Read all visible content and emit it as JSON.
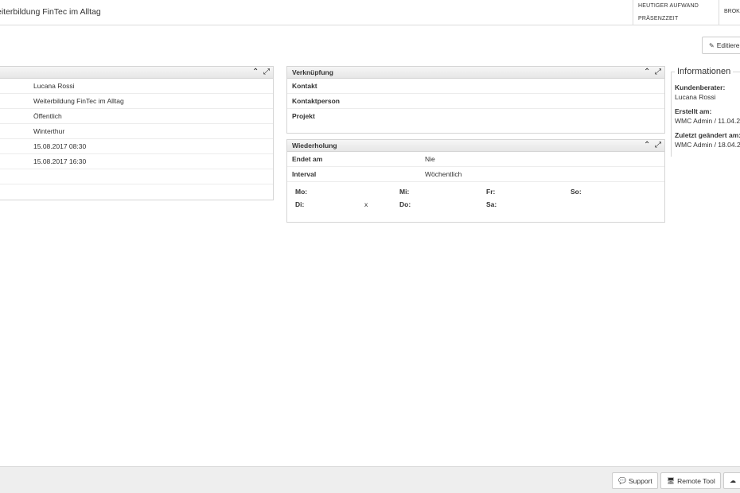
{
  "header": {
    "title": "eiterbildung FinTec im Alltag",
    "today_effort": "HEUTIGER AUFWAND",
    "presence": "PRÄSENZZEIT",
    "broker": "BROK"
  },
  "toolbar": {
    "edit_label": "Editiere"
  },
  "details": {
    "rows": [
      {
        "value": "Lucana Rossi"
      },
      {
        "value": "Weiterbildung FinTec im Alltag"
      },
      {
        "value": "Öffentlich"
      },
      {
        "value": "Winterthur"
      },
      {
        "value": "15.08.2017 08:30"
      },
      {
        "value": "15.08.2017 16:30"
      },
      {
        "value": ""
      }
    ]
  },
  "link_panel": {
    "title": "Verknüpfung",
    "rows": [
      {
        "label": "Kontakt"
      },
      {
        "label": "Kontaktperson"
      },
      {
        "label": "Projekt"
      }
    ]
  },
  "repeat_panel": {
    "title": "Wiederholung",
    "rows": [
      {
        "label": "Endet am",
        "value": "Nie"
      },
      {
        "label": "Interval",
        "value": "Wöchentlich"
      }
    ],
    "days": {
      "mo": "Mo:",
      "mi": "Mi:",
      "fr": "Fr:",
      "so": "So:",
      "di": "Di:",
      "di_val": "x",
      "do": "Do:",
      "sa": "Sa:"
    }
  },
  "info": {
    "title": "Informationen",
    "advisor_label": "Kundenberater:",
    "advisor_value": "Lucana Rossi",
    "created_label": "Erstellt am:",
    "created_value": "WMC Admin / 11.04.2",
    "modified_label": "Zuletzt geändert am:",
    "modified_value": "WMC Admin / 18.04.2"
  },
  "footer": {
    "support_label": "Support",
    "remote_label": "Remote Tool"
  },
  "icons": {
    "collapse": "chevron-up-icon",
    "expand": "expand-icon",
    "edit": "pencil-icon",
    "support": "chat-icon",
    "remote": "monitor-icon",
    "cloud": "cloud-icon"
  }
}
